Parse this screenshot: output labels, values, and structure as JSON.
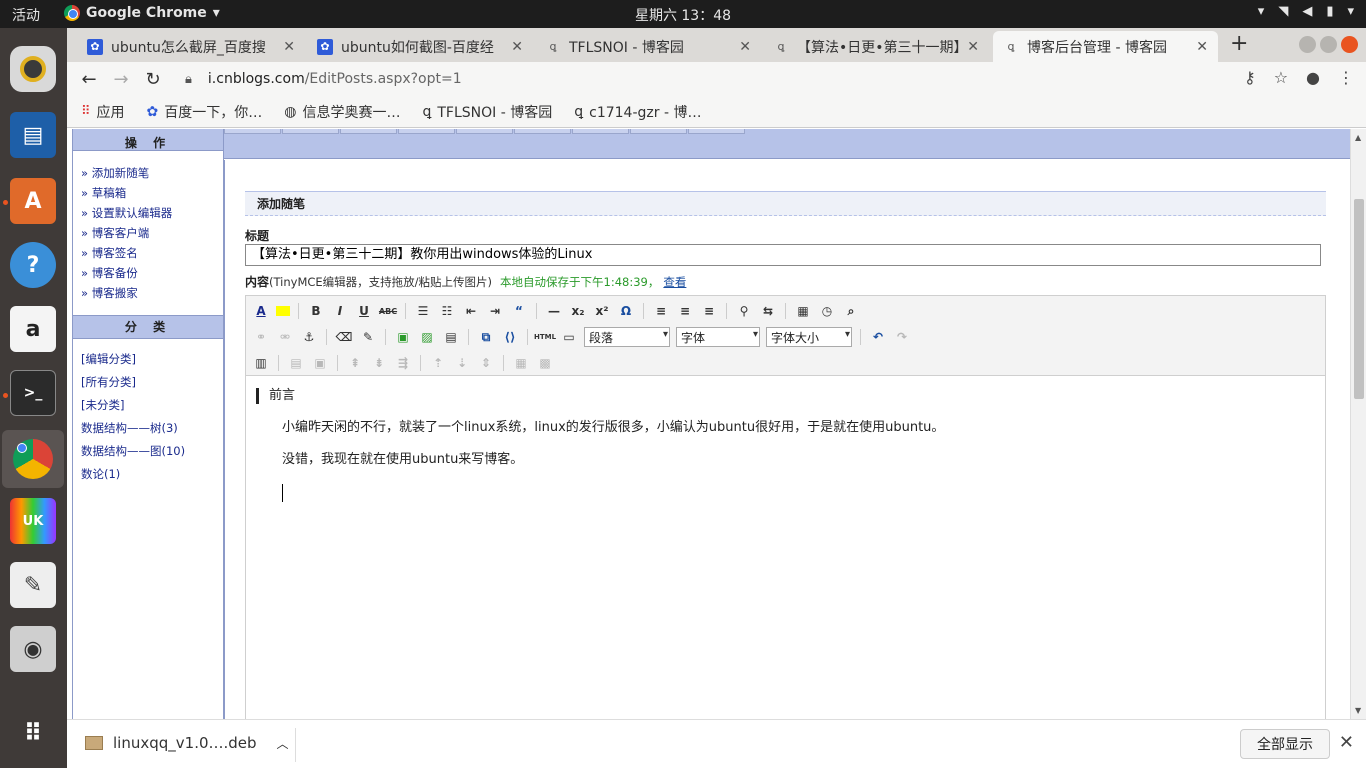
{
  "topbar": {
    "activities": "活动",
    "app_name": "Google Chrome",
    "clock": "星期六 13：48"
  },
  "dock": {
    "items": [
      "rhythmbox-icon",
      "libreoffice-writer-icon",
      "software-center-icon",
      "help-icon",
      "amazon-icon",
      "terminal-icon",
      "chrome-icon",
      "ubuntu-kylin-icon",
      "text-editor-icon",
      "screenshot-icon",
      "show-apps-icon"
    ]
  },
  "tabs": [
    {
      "title": "ubuntu怎么截屏_百度搜",
      "icon": "baidu-icon"
    },
    {
      "title": "ubuntu如何截图-百度经",
      "icon": "baidu-icon"
    },
    {
      "title": "TFLSNOI - 博客园",
      "icon": "cnblogs-icon"
    },
    {
      "title": "【算法•日更•第三十一期】",
      "icon": "cnblogs-icon"
    },
    {
      "title": "博客后台管理 - 博客园",
      "icon": "cnblogs-icon"
    }
  ],
  "omnibox": {
    "host": "i.cnblogs.com",
    "path": "/EditPosts.aspx?opt=1"
  },
  "bookmarks": [
    {
      "label": "应用",
      "icon": "apps-grid-icon"
    },
    {
      "label": "百度一下，你…",
      "icon": "baidu-icon"
    },
    {
      "label": "信息学奥赛一…",
      "icon": "globe-icon"
    },
    {
      "label": "TFLSNOI - 博客园",
      "icon": "cnblogs-icon"
    },
    {
      "label": "c1714-gzr - 博…",
      "icon": "cnblogs-icon"
    }
  ],
  "sidebar": {
    "ops_title": "操 作",
    "ops": [
      "» 添加新随笔",
      "» 草稿箱",
      "» 设置默认编辑器",
      "» 博客客户端",
      "» 博客签名",
      "» 博客备份",
      "» 博客搬家"
    ],
    "cat_title": "分 类",
    "cats": [
      "[编辑分类]",
      "[所有分类]",
      "[未分类]",
      "数据结构——树(3)",
      "数据结构——图(10)",
      "数论(1)"
    ]
  },
  "main": {
    "section_title": "添加随笔",
    "title_label": "标题",
    "title_value": "【算法•日更•第三十二期】教你用出windows体验的Linux",
    "content_label": "内容",
    "content_hint": "(TinyMCE编辑器，支持拖放/粘贴上传图片)",
    "autosave": "本地自动保存于下午1:48:39，",
    "view_link": "查看"
  },
  "editor": {
    "format_select": "段落",
    "font_select": "字体",
    "size_select": "字体大小",
    "heading": "前言",
    "para1": "小编昨天闲的不行，就装了一个linux系统，linux的发行版很多，小编认为ubuntu很好用，于是就在使用ubuntu。",
    "para2": "没错，我现在就在使用ubuntu来写博客。"
  },
  "downloads": {
    "file": "linuxqq_v1.0….deb",
    "show_all": "全部显示"
  }
}
